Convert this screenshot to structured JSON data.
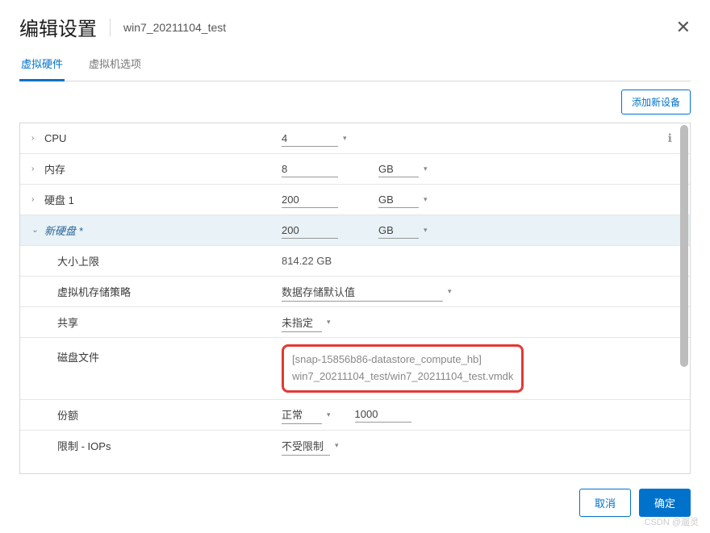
{
  "header": {
    "title": "编辑设置",
    "subtitle": "win7_20211104_test"
  },
  "tabs": {
    "hardware": "虚拟硬件",
    "options": "虚拟机选项"
  },
  "toolbar": {
    "add_device": "添加新设备"
  },
  "rows": {
    "cpu": {
      "label": "CPU",
      "value": "4"
    },
    "memory": {
      "label": "内存",
      "value": "8",
      "unit": "GB"
    },
    "disk1": {
      "label": "硬盘 1",
      "value": "200",
      "unit": "GB"
    },
    "newdisk": {
      "label": "新硬盘 *",
      "value": "200",
      "unit": "GB"
    },
    "max_size": {
      "label": "大小上限",
      "value": "814.22 GB"
    },
    "storage_policy": {
      "label": "虚拟机存储策略",
      "value": "数据存储默认值"
    },
    "sharing": {
      "label": "共享",
      "value": "未指定"
    },
    "disk_file": {
      "label": "磁盘文件",
      "line1": "[snap-15856b86-datastore_compute_hb]",
      "line2": "win7_20211104_test/win7_20211104_test.vmdk"
    },
    "shares": {
      "label": "份额",
      "value": "正常",
      "num": "1000"
    },
    "limit_iops": {
      "label": "限制 - IOPs",
      "value": "不受限制"
    }
  },
  "footer": {
    "cancel": "取消",
    "ok": "确定"
  },
  "watermark": "CSDN @遛灵"
}
